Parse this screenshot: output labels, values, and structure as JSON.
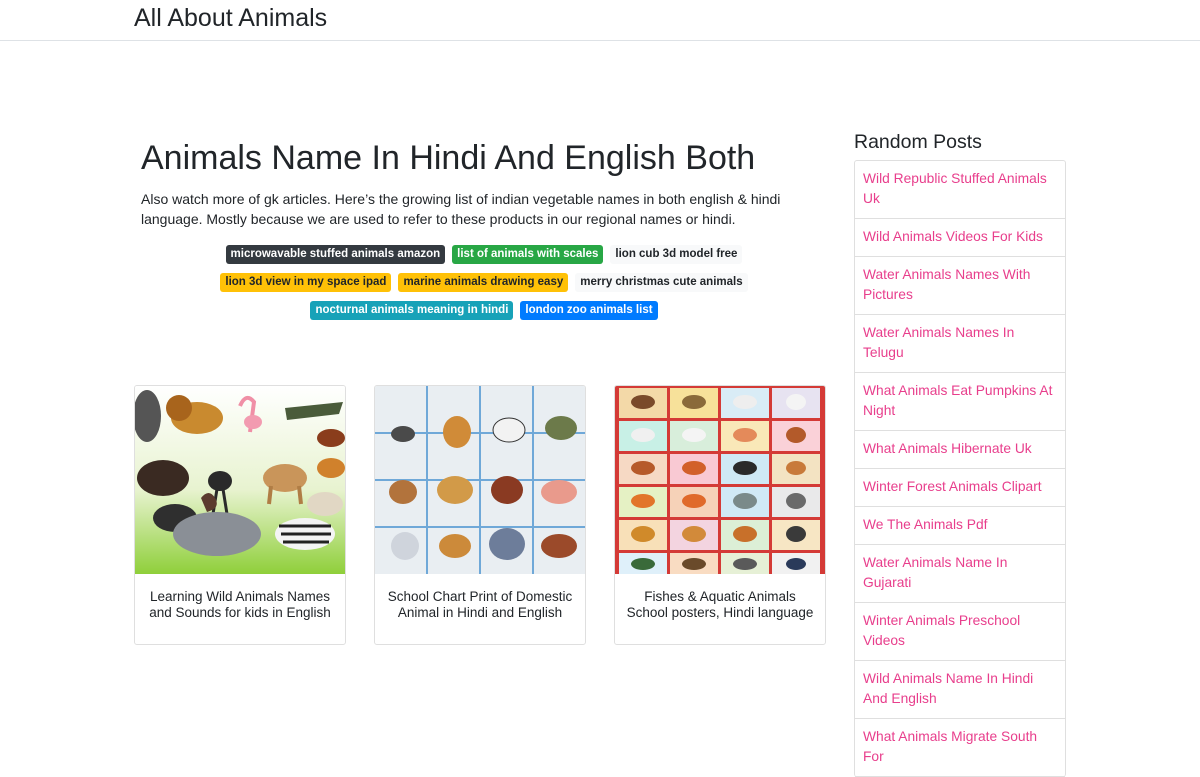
{
  "site": {
    "brand": "All About Animals"
  },
  "article": {
    "title": "Animals Name In Hindi And English Both",
    "intro": "Also watch more of gk articles. Here’s the growing list of indian vegetable names in both english & hindi language. Mostly because we are used to refer to these products in our regional names or hindi.",
    "tag_rows": [
      [
        {
          "label": "microwavable stuffed animals amazon",
          "color": "#343a40"
        },
        {
          "label": "list of animals with scales",
          "color": "#28a745"
        },
        {
          "label": "lion cub 3d model free",
          "color": "#f8f9fa"
        }
      ],
      [
        {
          "label": "lion 3d view in my space ipad",
          "color": "#ffc107"
        },
        {
          "label": "marine animals drawing easy",
          "color": "#ffc107"
        },
        {
          "label": "merry christmas cute animals",
          "color": "#f8f9fa"
        }
      ],
      [
        {
          "label": "nocturnal animals meaning in hindi",
          "color": "#17a2b8"
        },
        {
          "label": "london zoo animals list",
          "color": "#007bff"
        }
      ]
    ],
    "cards": [
      {
        "caption": "Learning Wild Animals Names and Sounds for kids in English",
        "image": "wild-animals-collage"
      },
      {
        "caption": "School Chart Print of Domestic Animal in Hindi and English",
        "image": "domestic-animals-chart"
      },
      {
        "caption": "Fishes & Aquatic Animals School posters, Hindi language",
        "image": "animal-poster-grid"
      }
    ]
  },
  "sidebar": {
    "heading": "Random Posts",
    "posts": [
      "Wild Republic Stuffed Animals Uk",
      "Wild Animals Videos For Kids",
      "Water Animals Names With Pictures",
      "Water Animals Names In Telugu",
      "What Animals Eat Pumpkins At Night",
      "What Animals Hibernate Uk",
      "Winter Forest Animals Clipart",
      "We The Animals Pdf",
      "Water Animals Name In Gujarati",
      "Winter Animals Preschool Videos",
      "Wild Animals Name In Hindi And English",
      "What Animals Migrate South For"
    ]
  },
  "colors": {
    "link": "#e83e8c",
    "border": "#dfdfdf"
  }
}
